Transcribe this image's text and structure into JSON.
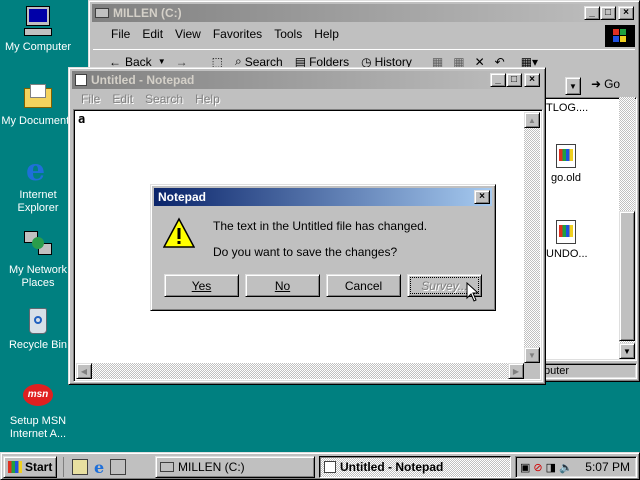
{
  "desktop": {
    "icons": [
      {
        "label": "My Computer"
      },
      {
        "label": "My Documents"
      },
      {
        "label": "Internet Explorer"
      },
      {
        "label": "My Network Places"
      },
      {
        "label": "Recycle Bin"
      },
      {
        "label": "Setup MSN Internet A..."
      }
    ]
  },
  "explorer": {
    "title": "MILLEN (C:)",
    "menu": [
      "File",
      "Edit",
      "View",
      "Favorites",
      "Tools",
      "Help"
    ],
    "toolbar": {
      "back": "Back",
      "search": "Search",
      "folders": "Folders",
      "history": "History"
    },
    "go": "Go",
    "files": [
      "TLOG....",
      "go.old",
      "UNDO..."
    ],
    "status": "puter"
  },
  "notepad": {
    "title": "Untitled - Notepad",
    "menu": [
      "File",
      "Edit",
      "Search",
      "Help"
    ],
    "text": "a"
  },
  "dialog": {
    "title": "Notepad",
    "line1": "The text in the Untitled file has changed.",
    "line2": "Do you want to save the changes?",
    "buttons": {
      "yes": "Yes",
      "no": "No",
      "cancel": "Cancel",
      "survey": "Survey..."
    }
  },
  "taskbar": {
    "start": "Start",
    "tasks": [
      "MILLEN (C:)",
      "Untitled - Notepad"
    ],
    "clock": "5:07 PM"
  }
}
